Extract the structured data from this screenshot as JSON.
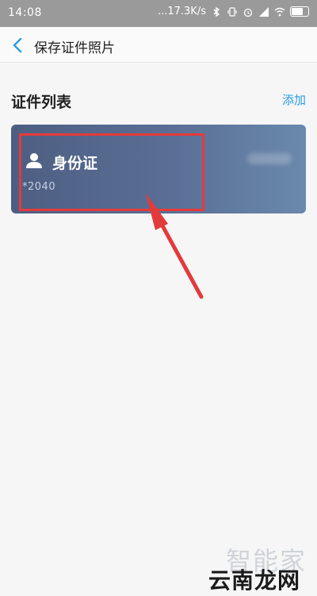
{
  "status_bar": {
    "time": "14:08",
    "network_speed": "...17.3K/s",
    "icons": [
      "bluetooth-icon",
      "vibrate-icon",
      "alarm-icon",
      "signal-icon",
      "wifi-icon",
      "battery-icon"
    ]
  },
  "nav": {
    "back_icon": "chevron-left-icon",
    "title": "保存证件照片"
  },
  "section": {
    "title": "证件列表",
    "add_label": "添加"
  },
  "card": {
    "icon": "person-icon",
    "name": "身份证",
    "number": "*2040"
  },
  "watermark": {
    "top": "智能家",
    "bottom": "云南龙网"
  },
  "colors": {
    "accent": "#2a9ce0",
    "card_gradient_start": "#4e5e82",
    "card_gradient_end": "#6a89ad",
    "highlight": "#e33b3b"
  }
}
